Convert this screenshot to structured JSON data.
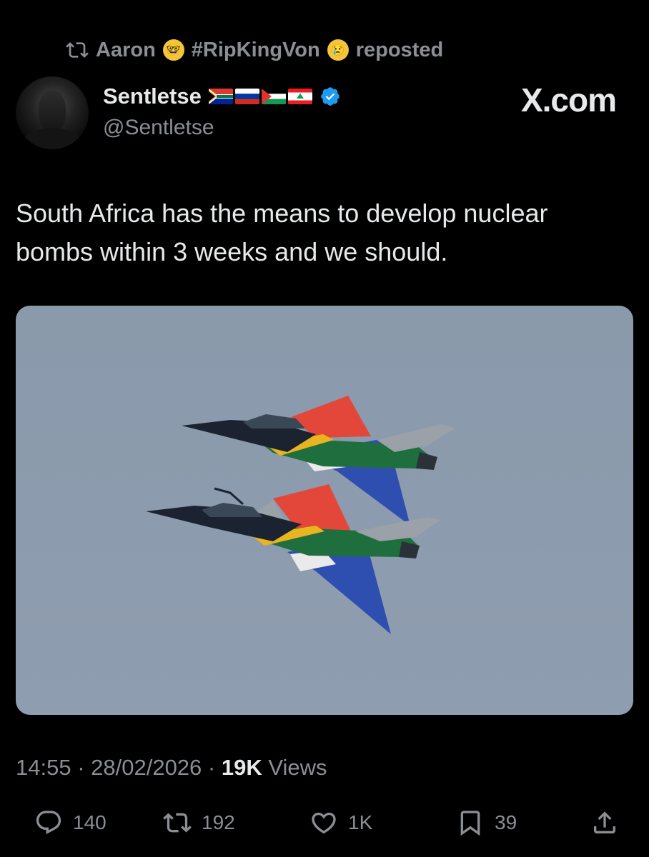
{
  "repost": {
    "user": "Aaron",
    "hashtag": "#RipKingVon",
    "label": "reposted",
    "icon": "repost-icon"
  },
  "author": {
    "name": "Sentletse",
    "handle": "@Sentletse",
    "flags": [
      "south-africa-flag",
      "russia-flag",
      "palestine-flag",
      "lebanon-flag"
    ],
    "verified": true
  },
  "brand": {
    "label": "X.com"
  },
  "tweet": {
    "line1": "South Africa has the means to develop nuclear",
    "line2": "bombs within 3 weeks and we should."
  },
  "media": {
    "icon": "fighter-jets-photo"
  },
  "meta": {
    "time": "14:55",
    "date": "28/02/2026",
    "views_count": "19K",
    "views_label": "Views"
  },
  "actions": {
    "replies": "140",
    "reposts": "192",
    "likes": "1K",
    "bookmarks": "39"
  },
  "colors": {
    "background": "#000000",
    "text": "#e7e9ea",
    "muted": "#8b8f94",
    "verified": "#1d9bf0",
    "sky": "#8c9bad"
  }
}
